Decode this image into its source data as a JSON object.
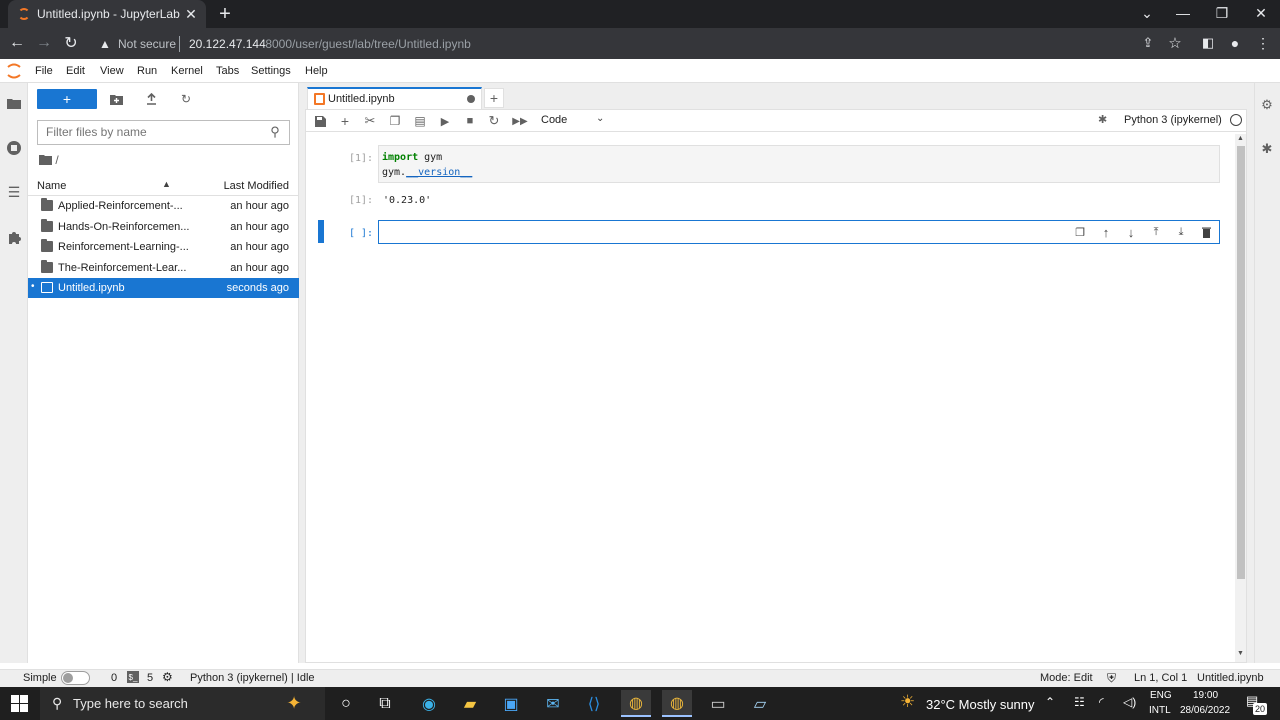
{
  "browser": {
    "tab_title": "Untitled.ipynb - JupyterLab",
    "security_label": "Not secure",
    "url_host": "20.122.47.144",
    "url_path": ":8000/user/guest/lab/tree/Untitled.ipynb"
  },
  "menubar": [
    "File",
    "Edit",
    "View",
    "Run",
    "Kernel",
    "Tabs",
    "Settings",
    "Help"
  ],
  "filebrowser": {
    "new_label": "+",
    "filter_placeholder": "Filter files by name",
    "breadcrumb": "/",
    "col_name": "Name",
    "col_modified": "Last Modified",
    "files": [
      {
        "name": "Applied-Reinforcement-...",
        "modified": "an hour ago",
        "type": "folder"
      },
      {
        "name": "Hands-On-Reinforcemen...",
        "modified": "an hour ago",
        "type": "folder"
      },
      {
        "name": "Reinforcement-Learning-...",
        "modified": "an hour ago",
        "type": "folder"
      },
      {
        "name": "The-Reinforcement-Lear...",
        "modified": "an hour ago",
        "type": "folder"
      },
      {
        "name": "Untitled.ipynb",
        "modified": "seconds ago",
        "type": "notebook"
      }
    ]
  },
  "notebook": {
    "tab_title": "Untitled.ipynb",
    "add_tab": "+",
    "cell_type": "Code",
    "kernel": "Python 3 (ipykernel)",
    "cells": [
      {
        "prompt": "[1]:",
        "line1_kw": "import",
        "line1_rest": " gym",
        "line2_obj": "gym.",
        "line2_attr": "__version__",
        "out_prompt": "[1]:",
        "output": "'0.23.0'"
      },
      {
        "prompt": "[ ]:"
      }
    ]
  },
  "statusbar": {
    "mode_label": "Simple",
    "terminals": "0",
    "kernels": "5",
    "kernel_status": "Python 3 (ipykernel) | Idle",
    "mode": "Mode: Edit",
    "cursor": "Ln 1, Col 1",
    "file": "Untitled.ipynb"
  },
  "taskbar": {
    "search_placeholder": "Type here to search",
    "weather": "32°C  Mostly sunny",
    "lang1": "ENG",
    "lang2": "INTL",
    "time": "19:00",
    "date": "28/06/2022",
    "notifications": "20"
  }
}
